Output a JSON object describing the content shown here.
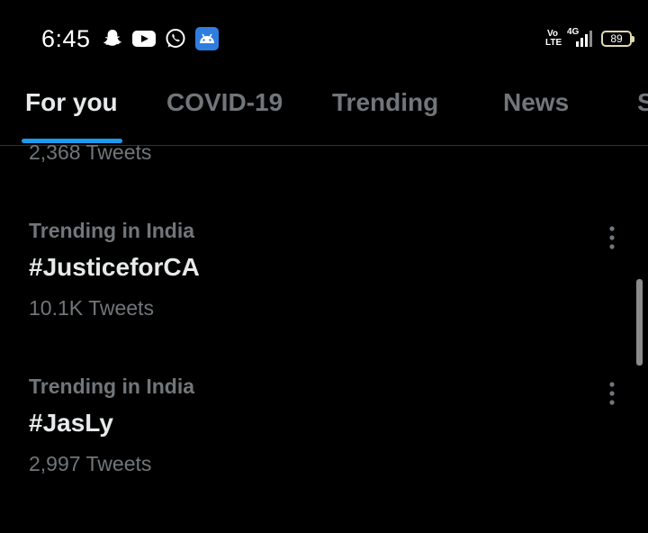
{
  "status_bar": {
    "time": "6:45",
    "network": "4G",
    "volte": [
      "Vo",
      "LTE"
    ],
    "battery": "89",
    "notification_icons": [
      "snapchat-icon",
      "youtube-icon",
      "whatsapp-icon",
      "android-icon"
    ]
  },
  "tabs": [
    {
      "label": "For you",
      "active": true
    },
    {
      "label": "COVID-19",
      "active": false
    },
    {
      "label": "Trending",
      "active": false
    },
    {
      "label": "News",
      "active": false
    },
    {
      "label": "S",
      "active": false
    }
  ],
  "partial_trend": {
    "count": "2,368 Tweets"
  },
  "trends": [
    {
      "context": "Trending in India",
      "name": "#JusticeforCA",
      "count": "10.1K Tweets"
    },
    {
      "context": "Trending in India",
      "name": "#JasLy",
      "count": "2,997 Tweets"
    }
  ],
  "colors": {
    "background": "#000000",
    "accent": "#1d9bf0",
    "primary_text": "#e7e9ea",
    "secondary_text": "#71767b",
    "divider": "#2f3336"
  }
}
